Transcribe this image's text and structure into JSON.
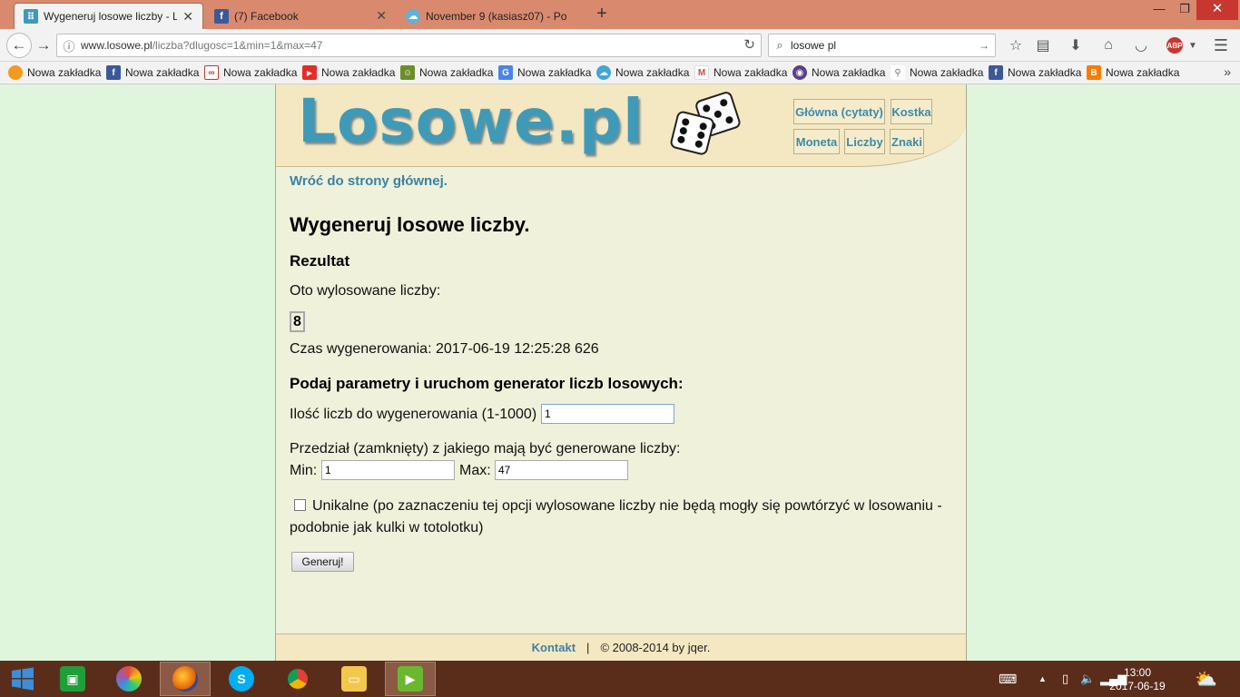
{
  "browser": {
    "tabs": [
      {
        "title": "Wygeneruj losowe liczby - Lo",
        "active": true
      },
      {
        "title": "(7) Facebook",
        "active": false
      },
      {
        "title": "November 9 (kasiasz07) - Po",
        "active": false
      }
    ],
    "new_tab": "+",
    "window": {
      "minimize": "—",
      "restore": "❐",
      "close": "✕"
    },
    "url_host": "www.losowe.pl",
    "url_path": "/liczba?dlugosc=1&min=1&max=47",
    "search_value": "losowe pl",
    "abp_label": "ABP",
    "bookmarks": [
      {
        "label": "Nowa zakładka",
        "icon": "orange-circle-icon",
        "color": "#f39a1e"
      },
      {
        "label": "Nowa zakładka",
        "icon": "facebook-icon",
        "color": "#3b5998"
      },
      {
        "label": "Nowa zakładka",
        "icon": "car-icon",
        "color": "#c0392b"
      },
      {
        "label": "Nowa zakładka",
        "icon": "youtube-icon",
        "color": "#e52d27"
      },
      {
        "label": "Nowa zakładka",
        "icon": "game-icon",
        "color": "#6a8f2a"
      },
      {
        "label": "Nowa zakładka",
        "icon": "translate-icon",
        "color": "#4a84e8"
      },
      {
        "label": "Nowa zakładka",
        "icon": "cloud-icon",
        "color": "#3fa7d6"
      },
      {
        "label": "Nowa zakładka",
        "icon": "gmail-icon",
        "color": "#d44638"
      },
      {
        "label": "Nowa zakładka",
        "icon": "eye-icon",
        "color": "#5b3f8c"
      },
      {
        "label": "Nowa zakładka",
        "icon": "pin-icon",
        "color": "#777777"
      },
      {
        "label": "Nowa zakładka",
        "icon": "facebook-icon",
        "color": "#3b5998"
      },
      {
        "label": "Nowa zakładka",
        "icon": "blogger-icon",
        "color": "#f57d00"
      }
    ]
  },
  "site": {
    "logo": "Losowe.pl",
    "nav": [
      "Główna (cytaty)",
      "Kostka",
      "Moneta",
      "Liczby",
      "Znaki"
    ],
    "back_link": "Wróć do strony głównej.",
    "title": "Wygeneruj losowe liczby.",
    "result_heading": "Rezultat",
    "result_intro": "Oto wylosowane liczby:",
    "result_value": "8",
    "generated_time": "Czas wygenerowania: 2017-06-19 12:25:28 626",
    "params_heading": "Podaj parametry i uruchom generator liczb losowych:",
    "count_label": "Ilość liczb do wygenerowania (1-1000)",
    "count_value": "1",
    "range_label": "Przedział (zamknięty) z jakiego mają być generowane liczby:",
    "min_label": "Min:",
    "min_value": "1",
    "max_label": "Max:",
    "max_value": "47",
    "unique_label_1": "Unikalne (po zaznaczeniu tej opcji wylosowane liczby nie będą mogły się powtórzyć w losowaniu -",
    "unique_label_2": "podobnie jak kulki w totolotku)",
    "unique_checked": false,
    "submit_label": "Generuj!",
    "footer_contact": "Kontakt",
    "footer_sep": "|",
    "footer_copy": "© 2008-2014 by jqer."
  },
  "taskbar": {
    "time": "13:00",
    "date": "2017-06-19"
  }
}
